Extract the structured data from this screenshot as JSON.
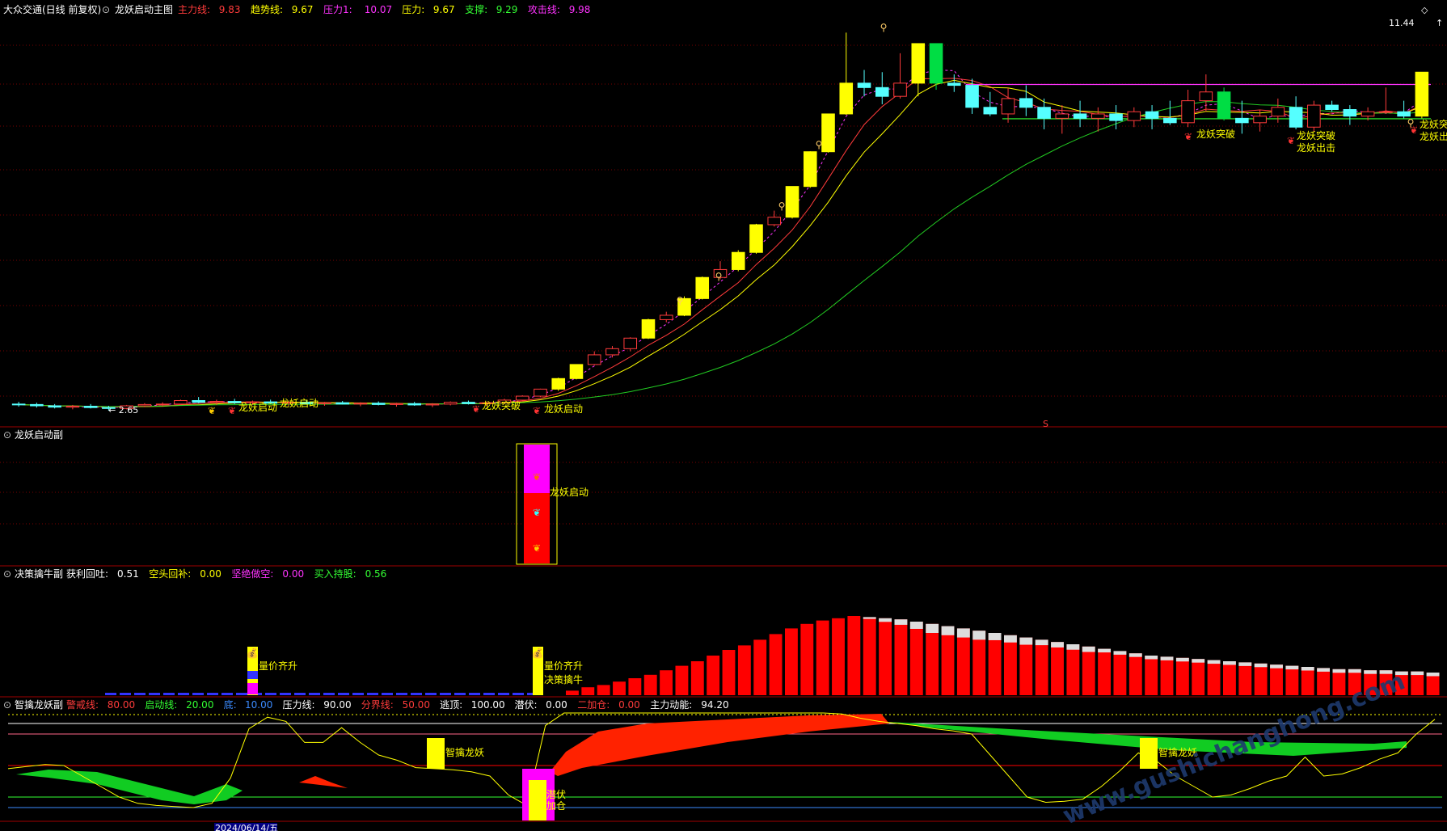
{
  "panel1": {
    "stock": "大众交通(日线 前复权)",
    "indicator": "龙妖启动主图",
    "params": [
      {
        "label": "主力线:",
        "value": "9.83",
        "color": "#ff3b3b"
      },
      {
        "label": "趋势线:",
        "value": "9.67",
        "color": "#ffff00"
      },
      {
        "label": "压力1:",
        "value": "10.07",
        "color": "#ff33ff"
      },
      {
        "label": "压力:",
        "value": "9.67",
        "color": "#ffff00"
      },
      {
        "label": "支撑:",
        "value": "9.29",
        "color": "#33ff33"
      },
      {
        "label": "攻击线:",
        "value": "9.98",
        "color": "#ff33ff"
      }
    ],
    "high_label": "11.44",
    "low_label": "← 2.65",
    "annotations": {
      "a1": "龙妖启动",
      "a2": "龙妖启动",
      "a3": "龙妖突破",
      "a4": "龙妖启动",
      "a5": "龙妖突破",
      "a6": "龙妖突破",
      "a7": "龙妖出击",
      "a8": "龙妖突",
      "a9": "龙妖出"
    },
    "s_marker": "S"
  },
  "panel2": {
    "indicator": "龙妖启动副",
    "annotation": "龙妖启动"
  },
  "panel3": {
    "indicator": "决策擒牛副",
    "params": [
      {
        "label": "获利回吐:",
        "value": "0.51",
        "color": "#ffffff"
      },
      {
        "label": "空头回补:",
        "value": "0.00",
        "color": "#ffff00"
      },
      {
        "label": "坚绝做空:",
        "value": "0.00",
        "color": "#ff33ff"
      },
      {
        "label": "买入持股:",
        "value": "0.56",
        "color": "#33ff33"
      }
    ],
    "annotations": {
      "a1": "量价齐升",
      "a2": "量价齐升",
      "a3": "决策擒牛"
    }
  },
  "panel4": {
    "indicator": "智擒龙妖副",
    "params": [
      {
        "label": "警戒线:",
        "value": "80.00",
        "color": "#ff3b3b"
      },
      {
        "label": "启动线:",
        "value": "20.00",
        "color": "#33ff33"
      },
      {
        "label": "底:",
        "value": "10.00",
        "color": "#3b8bff"
      },
      {
        "label": "压力线:",
        "value": "90.00",
        "color": "#ffffff"
      },
      {
        "label": "分界线:",
        "value": "50.00",
        "color": "#ff3b3b"
      },
      {
        "label": "逃顶:",
        "value": "100.00",
        "color": "#ffffff"
      },
      {
        "label": "潜伏:",
        "value": "0.00",
        "color": "#ffffff"
      },
      {
        "label": "二加仓:",
        "value": "0.00",
        "color": "#ff3b3b"
      },
      {
        "label": "主力动能:",
        "value": "94.20",
        "color": "#ffffff"
      }
    ],
    "annotations": {
      "a1": "智擒龙妖",
      "a2": "智擒龙妖",
      "a3": "潜伏",
      "a4": "加仓"
    }
  },
  "axis": {
    "date_label": "2024/06/14/五"
  },
  "watermark": "www.gushichanghong.com",
  "colors": {
    "up": "#ff3b3b",
    "down": "#55ffff",
    "yellow": "#ffff00",
    "magenta": "#ff33ff",
    "green": "#33ff33",
    "grid": "#7a0000",
    "axis": "#a00000"
  },
  "chart_data": [
    {
      "type": "candlestick",
      "title": "龙妖启动主图",
      "ylim": [
        2.65,
        11.44
      ],
      "candles": [
        [
          2.8,
          2.85,
          2.74,
          2.79
        ],
        [
          2.79,
          2.83,
          2.72,
          2.76
        ],
        [
          2.76,
          2.8,
          2.7,
          2.73
        ],
        [
          2.73,
          2.78,
          2.68,
          2.75
        ],
        [
          2.75,
          2.8,
          2.7,
          2.72
        ],
        [
          2.72,
          2.76,
          2.65,
          2.7
        ],
        [
          2.7,
          2.78,
          2.68,
          2.76
        ],
        [
          2.76,
          2.82,
          2.73,
          2.79
        ],
        [
          2.79,
          2.84,
          2.75,
          2.8
        ],
        [
          2.8,
          2.9,
          2.78,
          2.88
        ],
        [
          2.88,
          2.96,
          2.82,
          2.84
        ],
        [
          2.84,
          2.9,
          2.78,
          2.86
        ],
        [
          2.86,
          2.92,
          2.8,
          2.83
        ],
        [
          2.83,
          2.88,
          2.78,
          2.85
        ],
        [
          2.85,
          2.9,
          2.8,
          2.82
        ],
        [
          2.82,
          2.86,
          2.76,
          2.84
        ],
        [
          2.84,
          2.88,
          2.79,
          2.81
        ],
        [
          2.81,
          2.85,
          2.76,
          2.83
        ],
        [
          2.83,
          2.87,
          2.79,
          2.8
        ],
        [
          2.8,
          2.84,
          2.75,
          2.82
        ],
        [
          2.82,
          2.86,
          2.77,
          2.79
        ],
        [
          2.79,
          2.83,
          2.74,
          2.81
        ],
        [
          2.81,
          2.85,
          2.76,
          2.78
        ],
        [
          2.78,
          2.82,
          2.73,
          2.8
        ],
        [
          2.8,
          2.86,
          2.77,
          2.84
        ],
        [
          2.84,
          2.88,
          2.79,
          2.81
        ],
        [
          2.81,
          2.85,
          2.76,
          2.83
        ],
        [
          2.83,
          2.92,
          2.8,
          2.89
        ],
        [
          2.89,
          3.0,
          2.86,
          2.98
        ],
        [
          2.98,
          3.15,
          2.96,
          3.14
        ],
        [
          3.14,
          3.4,
          3.1,
          3.38
        ],
        [
          3.38,
          3.7,
          3.36,
          3.7
        ],
        [
          3.7,
          4.0,
          3.68,
          3.92
        ],
        [
          3.92,
          4.12,
          3.86,
          4.06
        ],
        [
          4.06,
          4.32,
          4.0,
          4.3
        ],
        [
          4.3,
          4.74,
          4.28,
          4.72
        ],
        [
          4.72,
          4.9,
          4.66,
          4.82
        ],
        [
          4.82,
          5.25,
          4.8,
          5.2
        ],
        [
          5.2,
          5.7,
          5.18,
          5.68
        ],
        [
          5.68,
          6.05,
          5.64,
          5.86
        ],
        [
          5.86,
          6.3,
          5.82,
          6.25
        ],
        [
          6.25,
          6.9,
          6.22,
          6.88
        ],
        [
          6.88,
          7.2,
          6.84,
          7.05
        ],
        [
          7.05,
          7.75,
          7.02,
          7.75
        ],
        [
          7.75,
          8.55,
          7.72,
          8.54
        ],
        [
          8.54,
          9.4,
          8.52,
          9.4
        ],
        [
          9.4,
          11.25,
          9.38,
          10.1
        ],
        [
          10.1,
          10.4,
          9.8,
          10.0
        ],
        [
          10.0,
          10.35,
          9.62,
          9.8
        ],
        [
          9.8,
          10.78,
          9.75,
          10.1
        ],
        [
          10.1,
          11.0,
          9.8,
          11.0
        ],
        [
          11.0,
          11.0,
          9.95,
          10.1
        ],
        [
          10.1,
          10.3,
          9.9,
          10.05
        ],
        [
          10.05,
          10.2,
          9.4,
          9.55
        ],
        [
          9.55,
          9.9,
          9.35,
          9.4
        ],
        [
          9.4,
          10.0,
          9.2,
          9.75
        ],
        [
          9.75,
          10.05,
          9.35,
          9.55
        ],
        [
          9.55,
          9.75,
          9.05,
          9.3
        ],
        [
          9.3,
          9.6,
          8.95,
          9.4
        ],
        [
          9.4,
          9.7,
          9.1,
          9.3
        ],
        [
          9.3,
          9.55,
          9.0,
          9.4
        ],
        [
          9.4,
          9.6,
          9.05,
          9.25
        ],
        [
          9.25,
          9.55,
          9.1,
          9.45
        ],
        [
          9.45,
          9.6,
          9.05,
          9.3
        ],
        [
          9.3,
          9.7,
          9.15,
          9.2
        ],
        [
          9.2,
          9.95,
          9.1,
          9.7
        ],
        [
          9.7,
          10.3,
          9.45,
          9.9
        ],
        [
          9.9,
          10.0,
          9.25,
          9.3
        ],
        [
          9.3,
          9.7,
          8.95,
          9.2
        ],
        [
          9.2,
          9.5,
          9.0,
          9.35
        ],
        [
          9.35,
          9.75,
          9.2,
          9.55
        ],
        [
          9.55,
          9.8,
          9.05,
          9.1
        ],
        [
          9.1,
          9.7,
          9.0,
          9.6
        ],
        [
          9.6,
          9.7,
          9.45,
          9.5
        ],
        [
          9.5,
          9.6,
          9.15,
          9.35
        ],
        [
          9.35,
          9.55,
          9.25,
          9.45
        ],
        [
          9.45,
          10.0,
          9.4,
          9.45
        ],
        [
          9.45,
          9.7,
          9.3,
          9.35
        ],
        [
          9.35,
          10.35,
          9.3,
          10.35
        ]
      ]
    },
    {
      "type": "bar",
      "title": "决策擒牛副",
      "red_bars": [
        4,
        7,
        9,
        12,
        15,
        18,
        22,
        26,
        30,
        35,
        40,
        44,
        49,
        54,
        59,
        63,
        66,
        68,
        70,
        69,
        68,
        67,
        65,
        63,
        61,
        59,
        57,
        55,
        53,
        51,
        49,
        47,
        45,
        43,
        41,
        39,
        37,
        35,
        34,
        33,
        32,
        31,
        30,
        29,
        28,
        27,
        26,
        25,
        24,
        23,
        23,
        22,
        22,
        21,
        21,
        20
      ],
      "white_tops": [
        0,
        0,
        0,
        0,
        0,
        0,
        0,
        0,
        0,
        0,
        0,
        0,
        0,
        0,
        0,
        0,
        0,
        0,
        0,
        1,
        2,
        3,
        4,
        5,
        5,
        5,
        5,
        4,
        4,
        4,
        3,
        3,
        3,
        3,
        2,
        2,
        2,
        2,
        2,
        2,
        2,
        2,
        2,
        2,
        2,
        2,
        2,
        2,
        2,
        2,
        2,
        2,
        2,
        2,
        2,
        2
      ]
    },
    {
      "type": "line",
      "title": "智擒龙妖副",
      "ylim": [
        0,
        100
      ],
      "reference_lines": [
        80,
        90,
        50,
        20,
        10
      ],
      "yellow_line": [
        47,
        49,
        51,
        50,
        40,
        30,
        20,
        14,
        12,
        11,
        10,
        14,
        38,
        85,
        96,
        92,
        72,
        72,
        86,
        72,
        60,
        55,
        48,
        47,
        46,
        44,
        40,
        22,
        12,
        88,
        100,
        100,
        100,
        100,
        100,
        100,
        100,
        100,
        100,
        100,
        100,
        100,
        100,
        100,
        100,
        99,
        95,
        92,
        90,
        88,
        85,
        83,
        80,
        60,
        40,
        20,
        15,
        16,
        18,
        30,
        45,
        62,
        54,
        40,
        30,
        20,
        22,
        28,
        35,
        40,
        58,
        40,
        42,
        48,
        56,
        62,
        80,
        94
      ]
    }
  ]
}
